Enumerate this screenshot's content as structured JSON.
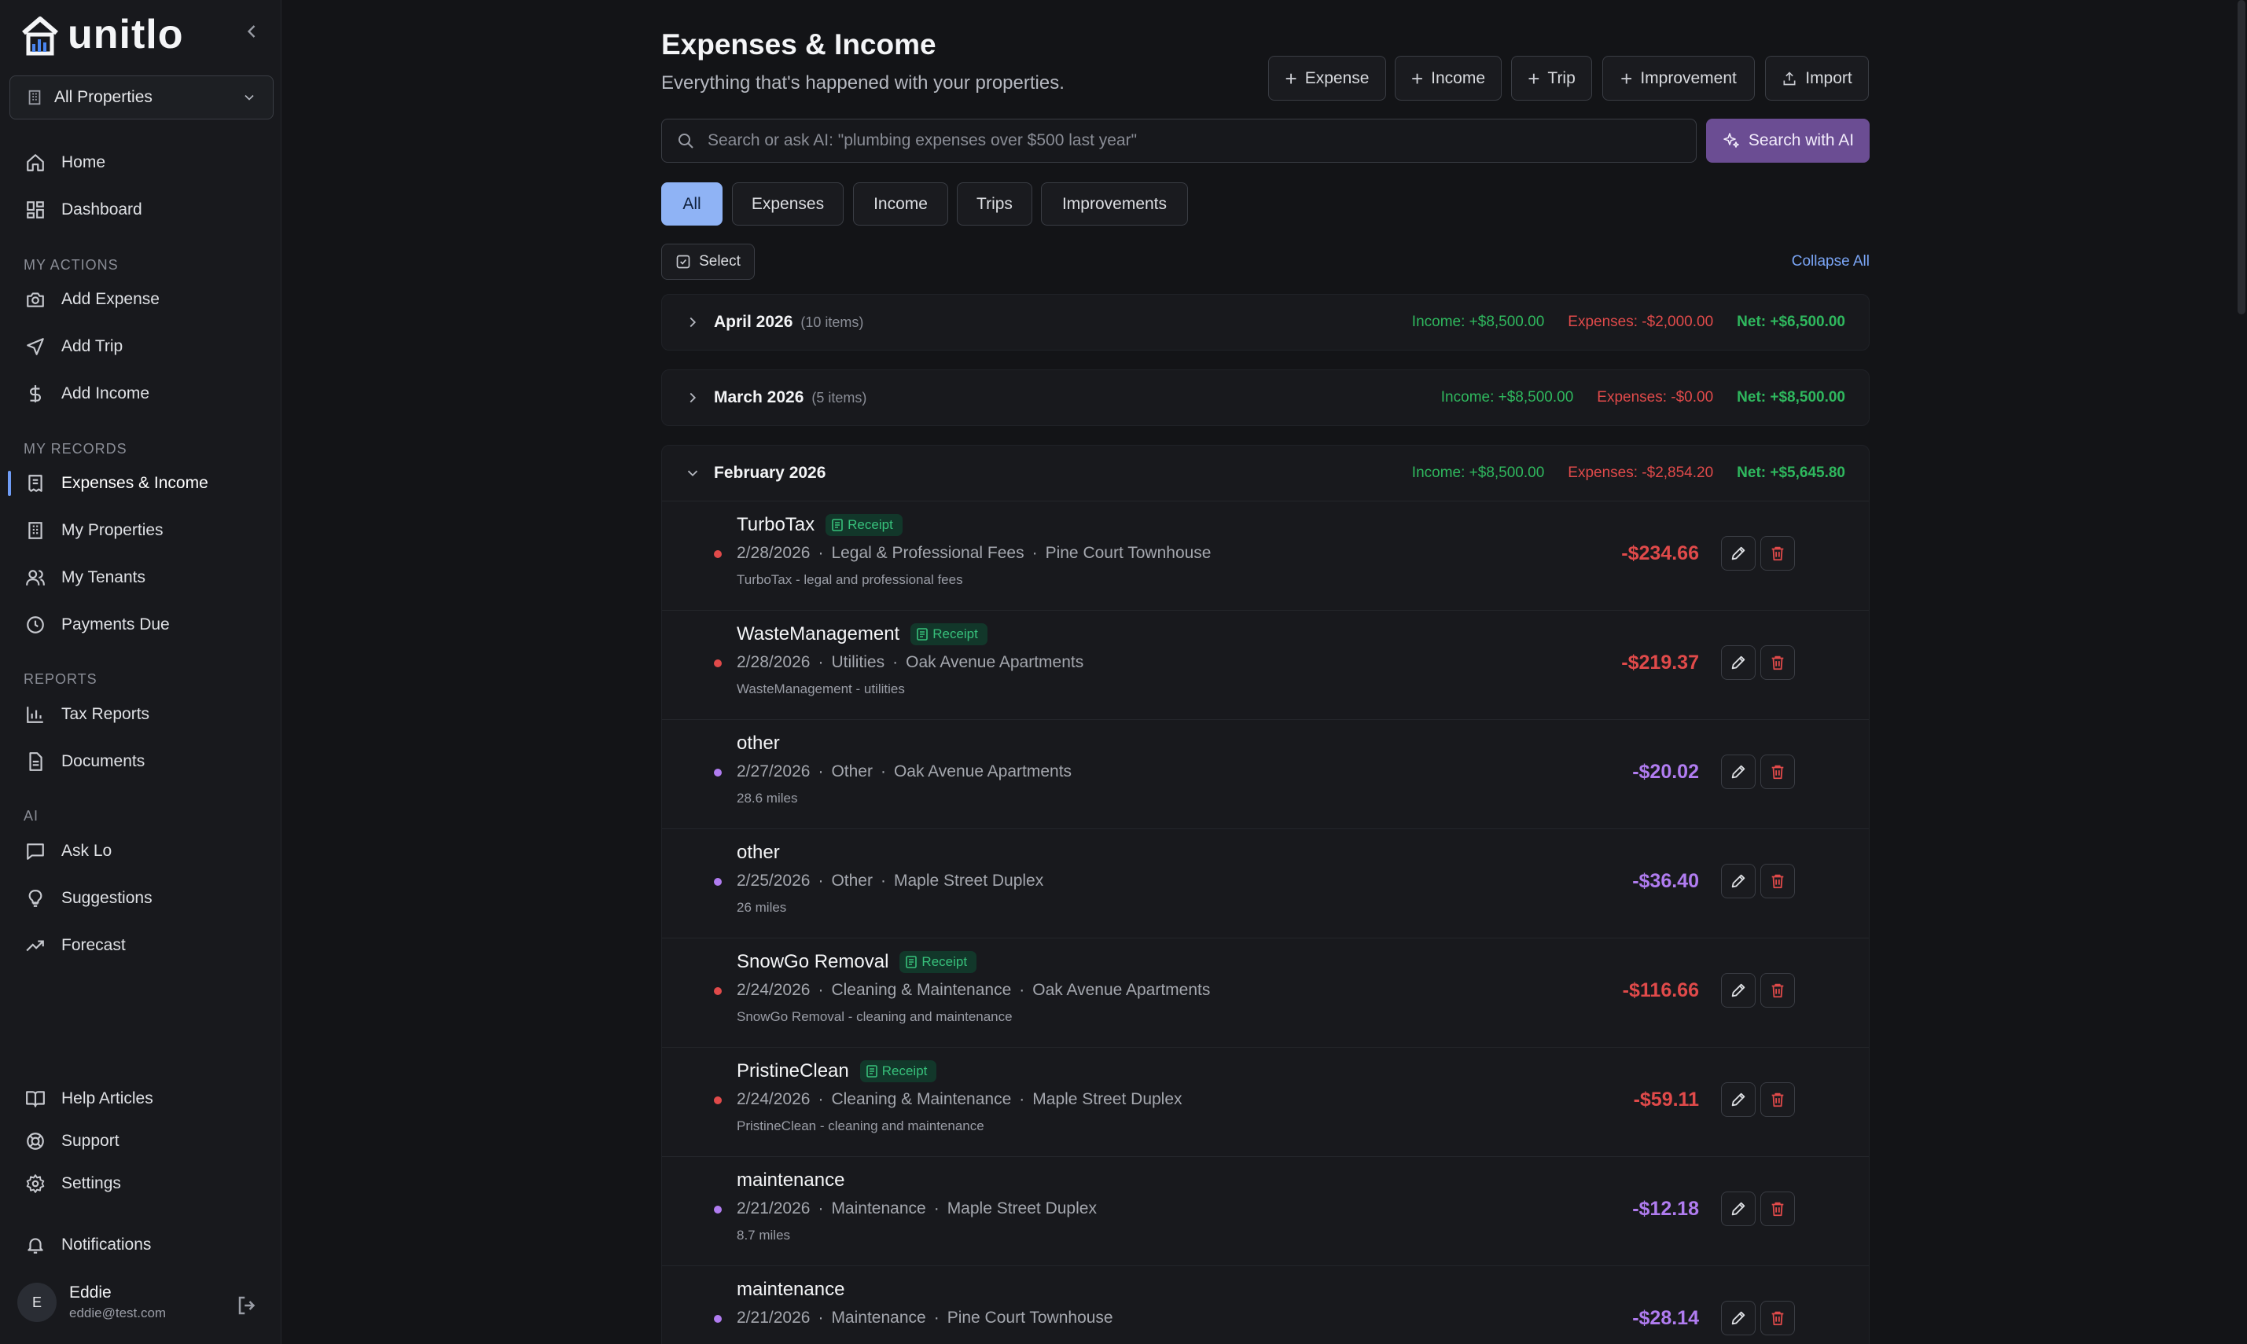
{
  "app": {
    "name": "unitlo"
  },
  "sidebar": {
    "property_selector": "All Properties",
    "top_items": [
      {
        "label": "Home",
        "icon": "home-icon"
      },
      {
        "label": "Dashboard",
        "icon": "dashboard-icon"
      }
    ],
    "sections": {
      "actions": "MY ACTIONS",
      "records": "MY RECORDS",
      "reports": "REPORTS",
      "ai": "AI"
    },
    "actions": [
      {
        "label": "Add Expense",
        "icon": "camera-icon"
      },
      {
        "label": "Add Trip",
        "icon": "send-icon"
      },
      {
        "label": "Add Income",
        "icon": "dollar-icon"
      }
    ],
    "records": [
      {
        "label": "Expenses & Income",
        "icon": "receipt-icon",
        "active": true
      },
      {
        "label": "My Properties",
        "icon": "building-icon"
      },
      {
        "label": "My Tenants",
        "icon": "users-icon"
      },
      {
        "label": "Payments Due",
        "icon": "clock-icon"
      }
    ],
    "reports": [
      {
        "label": "Tax Reports",
        "icon": "bar-chart-icon"
      },
      {
        "label": "Documents",
        "icon": "document-icon"
      }
    ],
    "ai": [
      {
        "label": "Ask Lo",
        "icon": "message-icon"
      },
      {
        "label": "Suggestions",
        "icon": "lightbulb-icon"
      },
      {
        "label": "Forecast",
        "icon": "trending-icon"
      }
    ],
    "bottom": [
      {
        "label": "Help Articles",
        "icon": "book-icon"
      },
      {
        "label": "Support",
        "icon": "lifebuoy-icon"
      },
      {
        "label": "Settings",
        "icon": "gear-icon"
      },
      {
        "label": "Notifications",
        "icon": "bell-icon"
      }
    ],
    "user": {
      "initial": "E",
      "name": "Eddie",
      "email": "eddie@test.com"
    }
  },
  "header": {
    "title": "Expenses & Income",
    "subtitle": "Everything that's happened with your properties.",
    "buttons": [
      "Expense",
      "Income",
      "Trip",
      "Improvement",
      "Import"
    ]
  },
  "search": {
    "placeholder": "Search or ask AI: \"plumbing expenses over $500 last year\"",
    "ai_button": "Search with AI"
  },
  "tabs": [
    "All",
    "Expenses",
    "Income",
    "Trips",
    "Improvements"
  ],
  "toolbar": {
    "select": "Select",
    "collapse_all": "Collapse All"
  },
  "groups": [
    {
      "title": "April 2026",
      "count": "(10 items)",
      "income": "Income: +$8,500.00",
      "expenses": "Expenses: -$2,000.00",
      "net": "Net: +$6,500.00"
    },
    {
      "title": "March 2026",
      "count": "(5 items)",
      "income": "Income: +$8,500.00",
      "expenses": "Expenses: -$0.00",
      "net": "Net: +$8,500.00"
    },
    {
      "title": "February 2026",
      "count": "",
      "income": "Income: +$8,500.00",
      "expenses": "Expenses: -$2,854.20",
      "net": "Net: +$5,645.80"
    }
  ],
  "badge_label": "Receipt",
  "entries": [
    {
      "name": "TurboTax",
      "receipt": true,
      "date": "2/28/2026",
      "category": "Legal & Professional Fees",
      "property": "Pine Court Townhouse",
      "note": "TurboTax - legal and professional fees",
      "amount": "-$234.66",
      "color": "red"
    },
    {
      "name": "WasteManagement",
      "receipt": true,
      "date": "2/28/2026",
      "category": "Utilities",
      "property": "Oak Avenue Apartments",
      "note": "WasteManagement - utilities",
      "amount": "-$219.37",
      "color": "red"
    },
    {
      "name": "other",
      "receipt": false,
      "date": "2/27/2026",
      "category": "Other",
      "property": "Oak Avenue Apartments",
      "note": "28.6 miles",
      "amount": "-$20.02",
      "color": "purple"
    },
    {
      "name": "other",
      "receipt": false,
      "date": "2/25/2026",
      "category": "Other",
      "property": "Maple Street Duplex",
      "note": "26 miles",
      "amount": "-$36.40",
      "color": "purple"
    },
    {
      "name": "SnowGo Removal",
      "receipt": true,
      "date": "2/24/2026",
      "category": "Cleaning & Maintenance",
      "property": "Oak Avenue Apartments",
      "note": "SnowGo Removal - cleaning and maintenance",
      "amount": "-$116.66",
      "color": "red"
    },
    {
      "name": "PristineClean",
      "receipt": true,
      "date": "2/24/2026",
      "category": "Cleaning & Maintenance",
      "property": "Maple Street Duplex",
      "note": "PristineClean - cleaning and maintenance",
      "amount": "-$59.11",
      "color": "red"
    },
    {
      "name": "maintenance",
      "receipt": false,
      "date": "2/21/2026",
      "category": "Maintenance",
      "property": "Maple Street Duplex",
      "note": "8.7 miles",
      "amount": "-$12.18",
      "color": "purple"
    },
    {
      "name": "maintenance",
      "receipt": false,
      "date": "2/21/2026",
      "category": "Maintenance",
      "property": "Pine Court Townhouse",
      "note": "",
      "amount": "-$28.14",
      "color": "purple"
    }
  ],
  "colors": {
    "accent": "#8fb3f5",
    "income": "#2fb85e",
    "expense": "#e04a4a",
    "mileage": "#b07cf0",
    "ai": "#6b4d93"
  }
}
